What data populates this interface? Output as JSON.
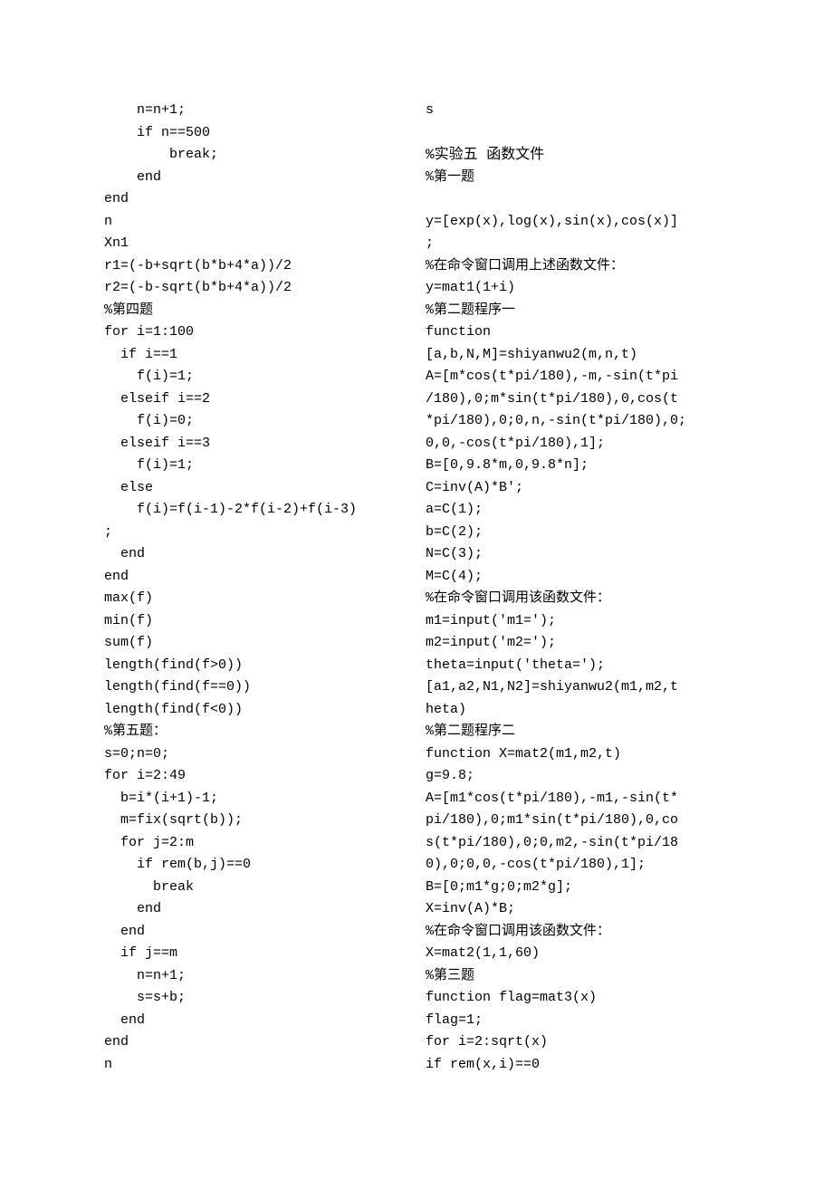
{
  "left_column": [
    "    n=n+1;",
    "    if n==500",
    "        break;",
    "    end",
    "end",
    "n",
    "Xn1",
    "r1=(-b+sqrt(b*b+4*a))/2",
    "r2=(-b-sqrt(b*b+4*a))/2",
    "%第四题",
    "for i=1:100",
    "  if i==1",
    "    f(i)=1;",
    "  elseif i==2",
    "    f(i)=0;",
    "  elseif i==3",
    "    f(i)=1;",
    "  else",
    "    f(i)=f(i-1)-2*f(i-2)+f(i-3)",
    ";",
    "  end",
    "end",
    "max(f)",
    "min(f)",
    "sum(f)",
    "length(find(f>0))",
    "length(find(f==0))",
    "length(find(f<0))",
    "%第五题：",
    "s=0;n=0;",
    "for i=2:49",
    "  b=i*(i+1)-1;",
    "  m=fix(sqrt(b));",
    "  for j=2:m",
    "    if rem(b,j)==0",
    "      break",
    "    end",
    "  end",
    "  if j==m",
    "    n=n+1;",
    "    s=s+b;",
    "  end",
    "end",
    "n"
  ],
  "right_column": [
    "s",
    "",
    {
      "text": "%实验五 函数文件",
      "class": "heading"
    },
    "%第一题",
    "",
    "y=[exp(x),log(x),sin(x),cos(x)]",
    ";",
    "%在命令窗口调用上述函数文件：",
    "y=mat1(1+i)",
    "%第二题程序一",
    "function",
    "[a,b,N,M]=shiyanwu2(m,n,t)",
    "A=[m*cos(t*pi/180),-m,-sin(t*pi",
    "/180),0;m*sin(t*pi/180),0,cos(t",
    "*pi/180),0;0,n,-sin(t*pi/180),0;",
    "0,0,-cos(t*pi/180),1];",
    "B=[0,9.8*m,0,9.8*n];",
    "C=inv(A)*B';",
    "a=C(1);",
    "b=C(2);",
    "N=C(3);",
    "M=C(4);",
    "%在命令窗口调用该函数文件：",
    "m1=input('m1=');",
    "m2=input('m2=');",
    "theta=input('theta=');",
    "[a1,a2,N1,N2]=shiyanwu2(m1,m2,t",
    "heta)",
    "%第二题程序二",
    "function X=mat2(m1,m2,t)",
    "g=9.8;",
    "A=[m1*cos(t*pi/180),-m1,-sin(t*",
    "pi/180),0;m1*sin(t*pi/180),0,co",
    "s(t*pi/180),0;0,m2,-sin(t*pi/18",
    "0),0;0,0,-cos(t*pi/180),1];",
    "B=[0;m1*g;0;m2*g];",
    "X=inv(A)*B;",
    "%在命令窗口调用该函数文件：",
    "X=mat2(1,1,60)",
    "%第三题",
    "function flag=mat3(x)",
    "flag=1;",
    "for i=2:sqrt(x)",
    "if rem(x,i)==0"
  ]
}
